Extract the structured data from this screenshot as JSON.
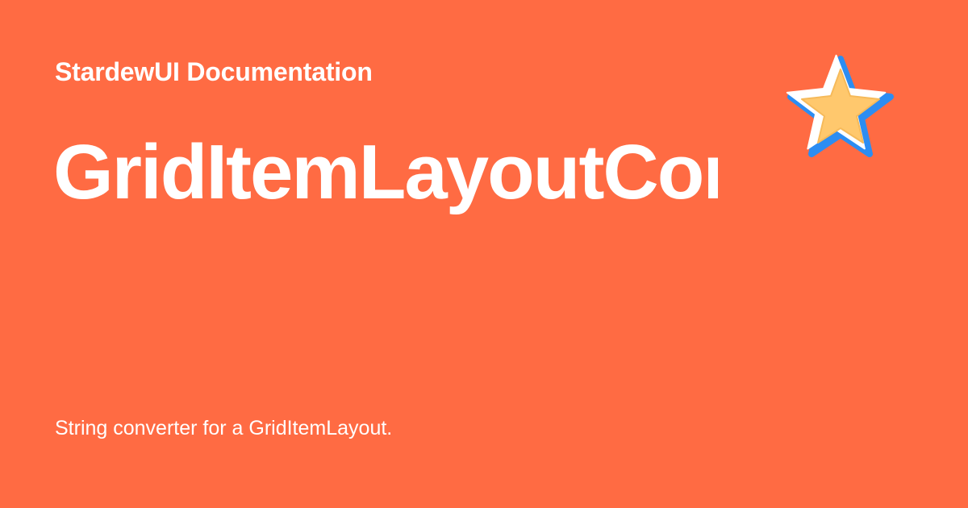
{
  "site": {
    "name": "StardewUI Documentation"
  },
  "page": {
    "title": "GridItemLayoutConverter",
    "description": "String converter for a GridItemLayout."
  },
  "logo": {
    "icon": "star-icon"
  },
  "colors": {
    "background": "#ff6b43",
    "text": "#ffffff",
    "star_fill": "#ffc86d",
    "star_outline_white": "#ffffff",
    "star_outline_blue": "#2c8df2"
  }
}
